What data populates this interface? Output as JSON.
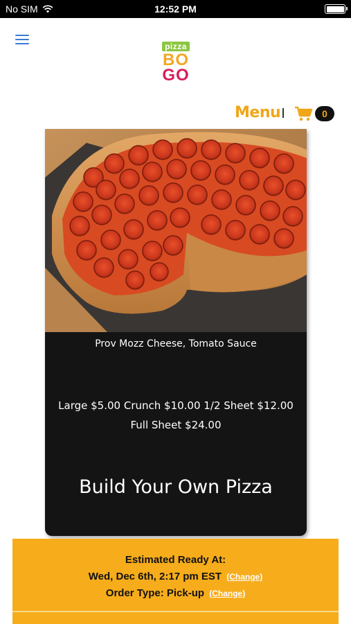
{
  "status_bar": {
    "carrier": "No SIM",
    "time": "12:52 PM",
    "icons": [
      "wifi-icon",
      "battery-icon"
    ]
  },
  "header": {
    "logo": {
      "top": "pizza",
      "line1_b": "B",
      "line1_o": "O",
      "line2_g": "G",
      "line2_o": "O"
    },
    "menu_label": "Menu",
    "cart_count": "0",
    "icons": [
      "hamburger-icon",
      "cart-icon"
    ]
  },
  "product": {
    "description": "Prov Mozz Cheese, Tomato Sauce",
    "prices_line1": "Large $5.00  Crunch $10.00  1/2 Sheet $12.00",
    "prices_line2": "Full Sheet $24.00",
    "title": "Build Your Own Pizza"
  },
  "order": {
    "ready_label": "Estimated Ready At:",
    "ready_time": "Wed, Dec 6th, 2:17 pm EST",
    "change_label": "(Change)",
    "order_type": "Order Type: Pick-up"
  },
  "colors": {
    "accent": "#f0a61a",
    "order_panel": "#f6ac1b",
    "card_bg": "#141414",
    "hamburger": "#3b7bd1"
  }
}
